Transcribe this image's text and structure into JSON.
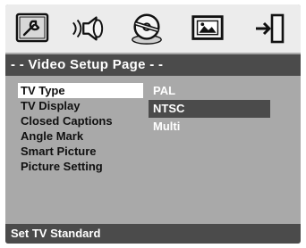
{
  "icon_bar": {
    "tabs": [
      {
        "icon": "general-setup-icon"
      },
      {
        "icon": "audio-setup-icon"
      },
      {
        "icon": "video-setup-icon",
        "active": true
      },
      {
        "icon": "preference-setup-icon"
      },
      {
        "icon": "exit-icon"
      }
    ]
  },
  "page_title": "- - Video Setup Page - -",
  "menu": {
    "items": [
      {
        "label": "TV Type",
        "selected": true
      },
      {
        "label": "TV Display"
      },
      {
        "label": "Closed Captions"
      },
      {
        "label": "Angle Mark"
      },
      {
        "label": "Smart Picture"
      },
      {
        "label": "Picture Setting"
      }
    ]
  },
  "options": {
    "items": [
      {
        "label": "PAL"
      },
      {
        "label": "NTSC",
        "selected": true
      },
      {
        "label": "Multi"
      }
    ]
  },
  "status": "Set TV Standard",
  "colors": {
    "background": "#a9a9a9",
    "bar": "#4b4b4b",
    "icon_bar": "#ececec",
    "highlight": "#ffffff"
  }
}
